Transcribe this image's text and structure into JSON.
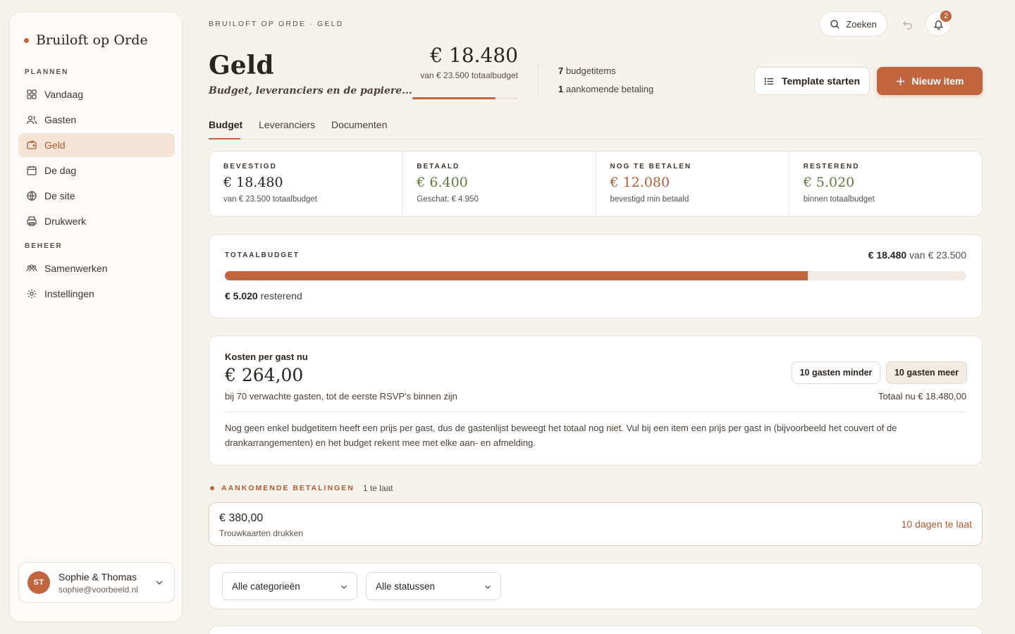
{
  "app": {
    "name": "Bruiloft op Orde"
  },
  "sidebar": {
    "section_plan": "PLANNEN",
    "section_manage": "BEHEER",
    "items": [
      {
        "label": "Vandaag",
        "icon": "grid-icon"
      },
      {
        "label": "Gasten",
        "icon": "users-icon"
      },
      {
        "label": "Geld",
        "icon": "wallet-icon"
      },
      {
        "label": "De dag",
        "icon": "calendar-icon"
      },
      {
        "label": "De site",
        "icon": "globe-icon"
      },
      {
        "label": "Drukwerk",
        "icon": "printer-icon"
      },
      {
        "label": "Samenwerken",
        "icon": "team-icon"
      },
      {
        "label": "Instellingen",
        "icon": "gear-icon"
      }
    ],
    "active": "Geld"
  },
  "user": {
    "initials": "ST",
    "name": "Sophie & Thomas",
    "email": "sophie@voorbeeld.nl"
  },
  "header": {
    "breadcrumb": "BRUILOFT OP ORDE · GELD",
    "search_label": "Zoeken",
    "notifications": "2",
    "title": "Geld",
    "subtitle": "Budget, leveranciers en de papiere...",
    "hero_amount": "€ 18.480",
    "hero_sub": "van € 23.500 totaalbudget",
    "hero_progress": 0.786,
    "stat1_num": "7",
    "stat1_text": " budgetitems",
    "stat2_num": "1",
    "stat2_text": " aankomende betaling",
    "template_btn": "Template starten",
    "new_btn": "Nieuw item"
  },
  "tabs": [
    "Budget",
    "Leveranciers",
    "Documenten"
  ],
  "summary": [
    {
      "label": "BEVESTIGD",
      "value": "€ 18.480",
      "note": "van € 23.500 totaalbudget",
      "color": "#2b2520"
    },
    {
      "label": "BETAALD",
      "value": "€ 6.400",
      "note": "Geschat: € 4.950",
      "color": "#5c7a3c"
    },
    {
      "label": "NOG TE BETALEN",
      "value": "€ 12.080",
      "note": "bevestigd min betaald",
      "color": "#b45a32"
    },
    {
      "label": "RESTEREND",
      "value": "€ 5.020",
      "note": "binnen totaalbudget",
      "color": "#5c7a3c"
    }
  ],
  "total_budget": {
    "label": "TOTAALBUDGET",
    "spent": "€ 18.480",
    "of_text": " van € 23.500",
    "progress": 0.786,
    "remaining": "€ 5.020",
    "remaining_text": " resterend"
  },
  "per_guest": {
    "label": "Kosten per gast nu",
    "amount": "€ 264,00",
    "note": "bij 70 verwachte gasten, tot de eerste RSVP's binnen zijn",
    "btn_less": "10 gasten minder",
    "btn_more": "10 gasten meer",
    "total": "Totaal nu € 18.480,00",
    "explanation": "Nog geen enkel budgetitem heeft een prijs per gast, dus de gastenlijst beweegt het totaal nog niet. Vul bij een item een prijs per gast in (bijvoorbeeld het couvert of de drankarrangementen) en het budget rekent mee met elke aan- en afmelding."
  },
  "upcoming": {
    "title": "AANKOMENDE BETALINGEN",
    "count": "1 te laat",
    "items": [
      {
        "amount": "€ 380,00",
        "desc": "Trouwkaarten drukken",
        "status": "10 dagen te laat"
      }
    ]
  },
  "filters": {
    "category": "Alle categorieën",
    "status": "Alle statussen"
  },
  "colors": {
    "accent": "#c1653f",
    "positive": "#5c7a3c",
    "background": "#f6f2ec"
  }
}
